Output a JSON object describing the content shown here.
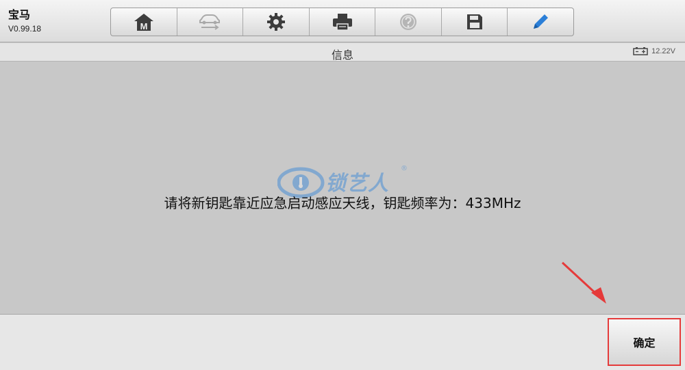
{
  "app": {
    "brand_name": "宝马",
    "version": "V0.99.18"
  },
  "toolbar": {
    "buttons": [
      {
        "name": "home-button",
        "icon": "home-icon",
        "label": "M"
      },
      {
        "name": "vehicle-swap-button",
        "icon": "car-swap-icon"
      },
      {
        "name": "settings-button",
        "icon": "gear-icon"
      },
      {
        "name": "print-button",
        "icon": "printer-icon"
      },
      {
        "name": "help-button",
        "icon": "question-icon"
      },
      {
        "name": "save-button",
        "icon": "floppy-disk-icon"
      },
      {
        "name": "edit-button",
        "icon": "pencil-icon"
      }
    ]
  },
  "header": {
    "title": "信息",
    "voltage": "12.22V"
  },
  "main": {
    "message": "请将新钥匙靠近应急启动感应天线，钥匙频率为：433MHz",
    "watermark_text": "锁艺人",
    "watermark_reg": "®"
  },
  "footer": {
    "ok_label": "确定"
  },
  "colors": {
    "highlight_border": "#e53a3a",
    "annotation_arrow": "#e53a3a",
    "watermark": "#4a8fd6"
  }
}
